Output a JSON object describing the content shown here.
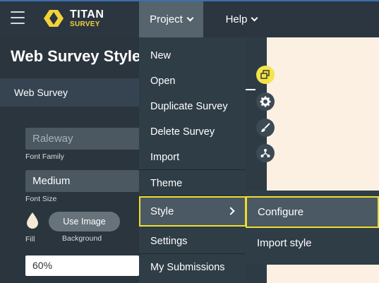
{
  "brand": {
    "name": "TITAN",
    "sub": "SURVEY"
  },
  "nav": {
    "project": "Project",
    "help": "Help"
  },
  "page": {
    "title": "Web Survey Style",
    "section": "Web Survey",
    "font_family_value": "Raleway",
    "font_family_caption": "Font Family",
    "font_size_value": "Medium",
    "font_size_caption": "Font Size",
    "fill_caption": "Fill",
    "use_image_label": "Use Image",
    "background_caption": "Background",
    "opacity_value": "60%"
  },
  "menu": {
    "items": [
      {
        "label": "New"
      },
      {
        "label": "Open"
      },
      {
        "label": "Duplicate Survey"
      },
      {
        "label": "Delete Survey"
      },
      {
        "label": "Import"
      },
      {
        "label": "Theme"
      },
      {
        "label": "Style"
      },
      {
        "label": "Settings"
      },
      {
        "label": "My Submissions"
      }
    ]
  },
  "submenu": {
    "configure": "Configure",
    "import_style": "Import style"
  },
  "colors": {
    "accent_yellow": "#f0dd2b",
    "topbar": "#2b3640",
    "preview_bg": "#fbf0e2"
  },
  "icons": [
    "menu-icon",
    "layers-icon",
    "gear-icon",
    "brush-icon",
    "share-icon",
    "droplet-icon"
  ]
}
